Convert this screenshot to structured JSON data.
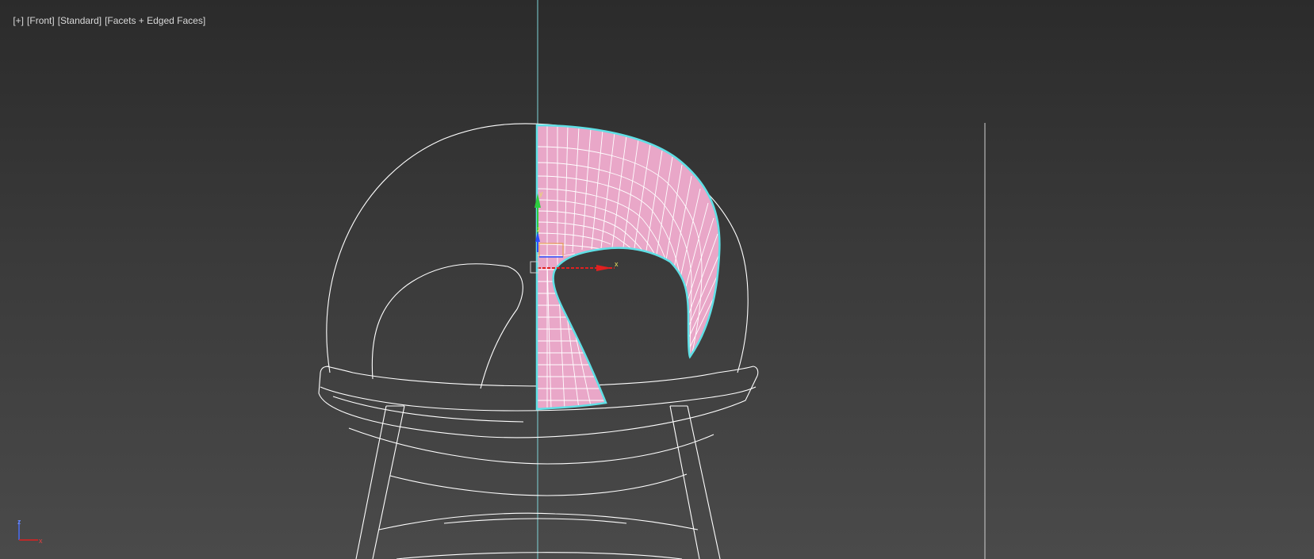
{
  "viewport": {
    "label_plus": "[+]",
    "label_view": "[Front]",
    "label_shading_mode": "[Standard]",
    "label_display": "[Facets + Edged Faces]"
  },
  "axis_tripod": {
    "x_label": "x",
    "z_label": "z"
  },
  "gizmo": {
    "x_label": "x",
    "y_label": "y",
    "z_label": "z"
  },
  "colors": {
    "background_top": "#2b2b2b",
    "background_bottom": "#4a4a4a",
    "wireframe": "#ffffff",
    "selection_outline": "#5fe0e6",
    "mesh_fill": "#e9a7c8",
    "y_axis": "#2ecc40",
    "x_axis": "#e02020",
    "z_axis": "#2a4fff"
  }
}
